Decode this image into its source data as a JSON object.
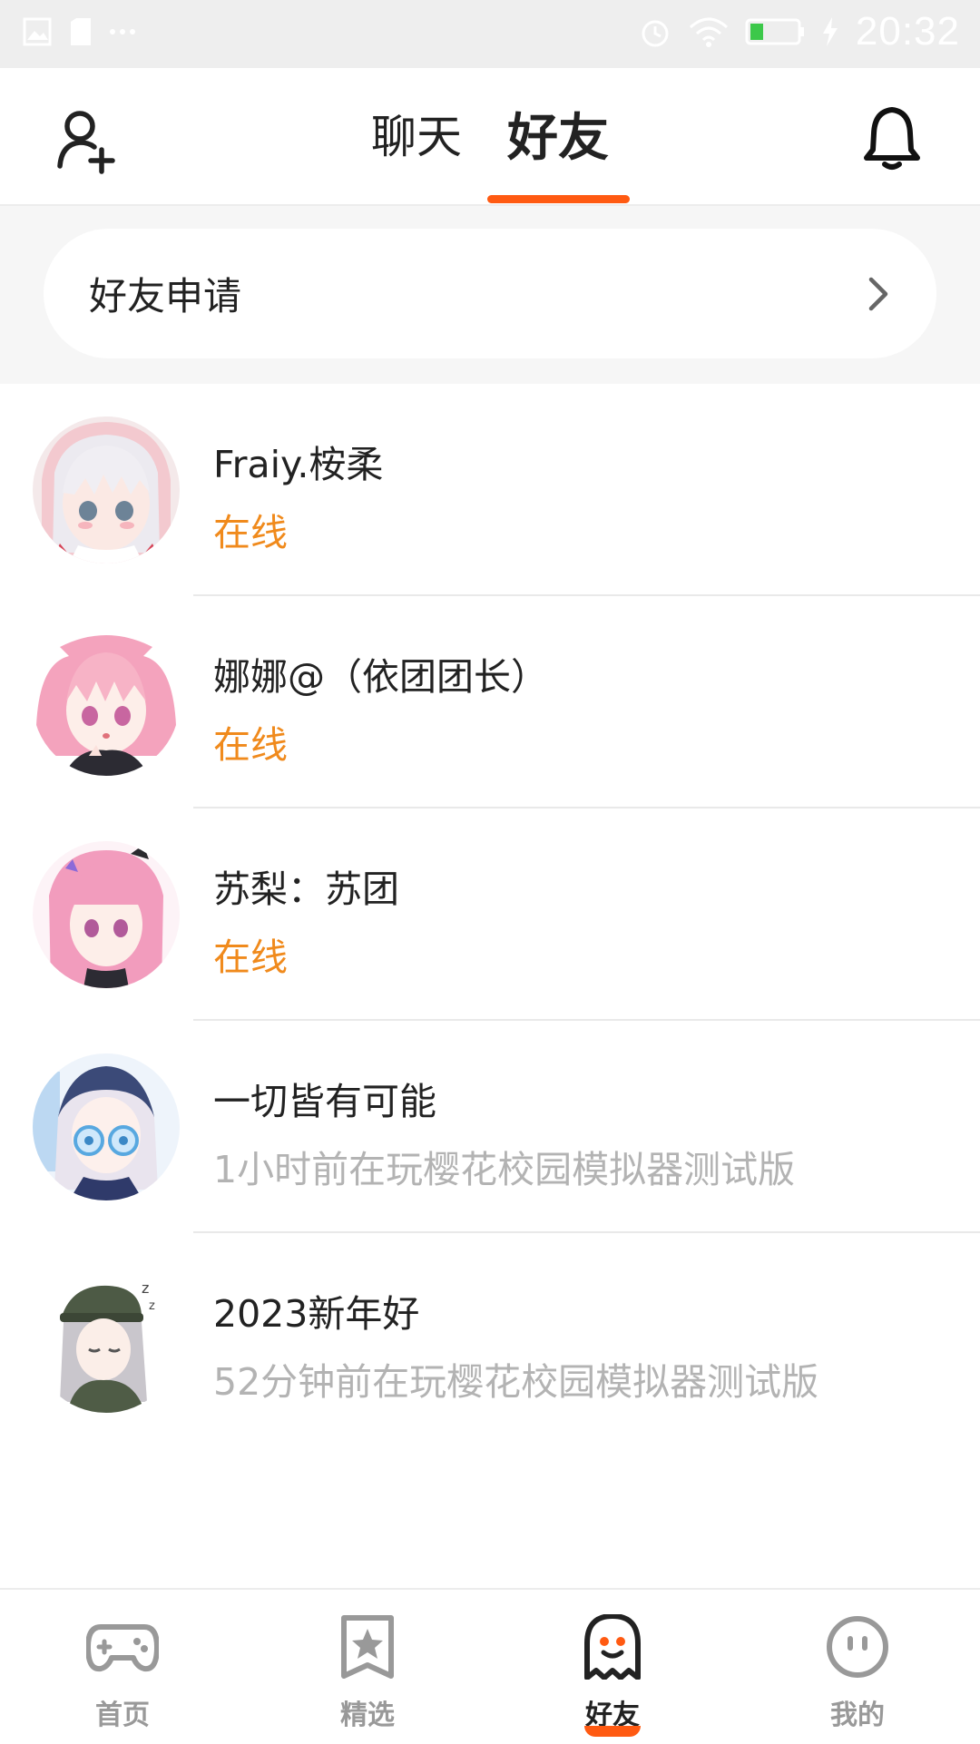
{
  "status_bar": {
    "time": "20:32",
    "battery_color": "#3cc84a",
    "icons": [
      "image-icon",
      "sd-card-icon",
      "more-icon",
      "alarm-icon",
      "wifi-icon",
      "battery-icon",
      "charging-icon"
    ]
  },
  "header": {
    "tabs": [
      {
        "label": "聊天",
        "active": false
      },
      {
        "label": "好友",
        "active": true
      }
    ],
    "left_icon": "add-friend-icon",
    "right_icon": "bell-icon",
    "accent": "#ff5a12"
  },
  "friend_request": {
    "label": "好友申请",
    "icon": "chevron-right-icon"
  },
  "friends": [
    {
      "name": "Fraiy.桉柔",
      "status": "在线",
      "online": true
    },
    {
      "name": "娜娜@（依团团长）",
      "status": "在线",
      "online": true
    },
    {
      "name": "苏梨：苏团",
      "status": "在线",
      "online": true
    },
    {
      "name": "一切皆有可能",
      "status": "1小时前在玩樱花校园模拟器测试版",
      "online": false
    },
    {
      "name": "2023新年好",
      "status": "52分钟前在玩樱花校园模拟器测试版",
      "online": false
    }
  ],
  "status_colors": {
    "online": "#f08a1c",
    "offline": "#b3b3b3"
  },
  "bottom_nav": {
    "items": [
      {
        "label": "首页",
        "icon": "gamepad-icon",
        "active": false
      },
      {
        "label": "精选",
        "icon": "star-bookmark-icon",
        "active": false
      },
      {
        "label": "好友",
        "icon": "ghost-icon",
        "active": true
      },
      {
        "label": "我的",
        "icon": "smiley-icon",
        "active": false
      }
    ]
  }
}
